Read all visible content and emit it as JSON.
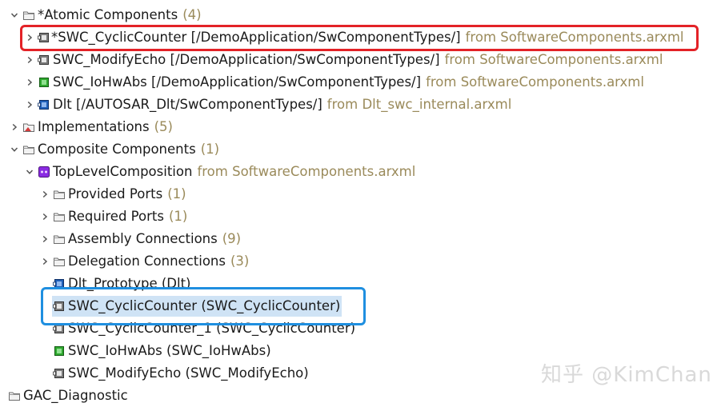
{
  "tree": {
    "atomic": {
      "label": "*Atomic Components",
      "count": "(4)"
    },
    "atomic_children": [
      {
        "dirty": "*",
        "label": "SWC_CyclicCounter [/DemoApplication/SwComponentTypes/]",
        "from": "from SoftwareComponents.arxml",
        "icon": "component-icon-gray"
      },
      {
        "dirty": "",
        "label": "SWC_ModifyEcho [/DemoApplication/SwComponentTypes/]",
        "from": "from SoftwareComponents.arxml",
        "icon": "component-icon-gray"
      },
      {
        "dirty": "",
        "label": "SWC_IoHwAbs [/DemoApplication/SwComponentTypes/]",
        "from": "from SoftwareComponents.arxml",
        "icon": "component-icon-green"
      },
      {
        "dirty": "",
        "label": "Dlt [/AUTOSAR_Dlt/SwComponentTypes/]",
        "from": "from Dlt_swc_internal.arxml",
        "icon": "component-icon-blue"
      }
    ],
    "implementations": {
      "label": "Implementations",
      "count": "(5)"
    },
    "composite": {
      "label": "Composite Components",
      "count": "(1)"
    },
    "toplevel": {
      "label": "TopLevelComposition",
      "from": "from SoftwareComponents.arxml"
    },
    "toplevel_children": [
      {
        "label": "Provided Ports",
        "count": "(1)"
      },
      {
        "label": "Required Ports",
        "count": "(1)"
      },
      {
        "label": "Assembly Connections",
        "count": "(9)"
      },
      {
        "label": "Delegation Connections",
        "count": "(3)"
      }
    ],
    "prototypes": [
      {
        "label": "Dlt_Prototype (Dlt)",
        "icon": "component-icon-blue"
      },
      {
        "label": "SWC_CyclicCounter (SWC_CyclicCounter)",
        "icon": "component-icon-gray"
      },
      {
        "label": "SWC_CyclicCounter_1 (SWC_CyclicCounter)",
        "icon": "component-icon-gray"
      },
      {
        "label": "SWC_IoHwAbs (SWC_IoHwAbs)",
        "icon": "component-icon-green"
      },
      {
        "label": "SWC_ModifyEcho (SWC_ModifyEcho)",
        "icon": "component-icon-gray"
      }
    ],
    "gac": {
      "label": "GAC_Diagnostic"
    }
  },
  "watermark": "知乎 @KimChan",
  "colors": {
    "highlight_red": "#e32227",
    "highlight_blue": "#1f8fe0",
    "selection": "#cfe3f5",
    "count_text": "#9a8a5a"
  }
}
